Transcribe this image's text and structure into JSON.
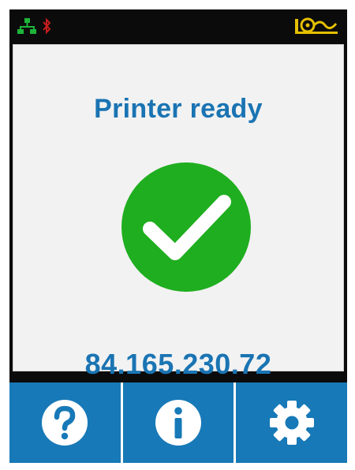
{
  "status_bar": {
    "icons": [
      "network-icon",
      "bluetooth-icon",
      "media-roll-icon"
    ]
  },
  "main": {
    "title": "Printer ready",
    "status_icon": "checkmark-circle-icon",
    "ip_address": "84.165.230.72"
  },
  "nav": {
    "items": [
      {
        "name": "help",
        "icon": "question-icon"
      },
      {
        "name": "info",
        "icon": "info-icon"
      },
      {
        "name": "settings",
        "icon": "gear-icon"
      }
    ]
  },
  "colors": {
    "accent_blue": "#1779b7",
    "title_blue": "#1a74b3",
    "success_green": "#1fae1f",
    "network_green": "#1db43a",
    "bluetooth_red": "#c81e1e",
    "media_yellow": "#e5c000"
  }
}
